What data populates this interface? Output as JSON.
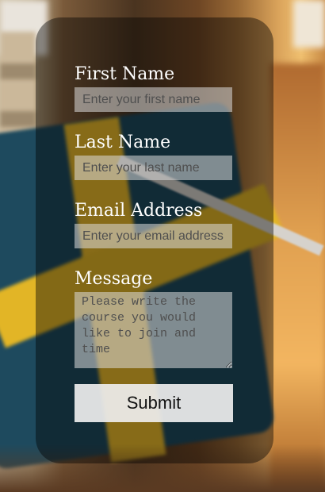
{
  "form": {
    "first_name_label": "First Name",
    "first_name_placeholder": "Enter your first name",
    "last_name_label": "Last Name",
    "last_name_placeholder": "Enter your last name",
    "email_label": "Email Address",
    "email_placeholder": "Enter your email address",
    "message_label": "Message",
    "message_placeholder": "Please write the course you would like to join and time",
    "submit_label": "Submit"
  },
  "colors": {
    "label_text": "#ffffff",
    "card_overlay": "rgba(0,0,0,0.42)",
    "field_background": "rgba(220,220,220,0.55)",
    "button_background": "#eeeeee"
  }
}
